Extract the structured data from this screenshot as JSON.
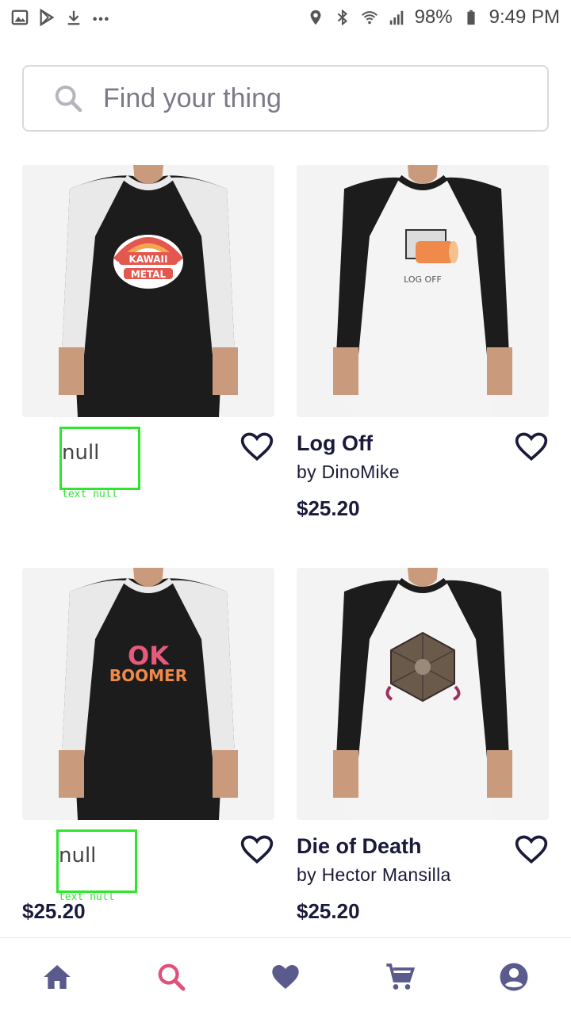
{
  "status_bar": {
    "battery": "98%",
    "time": "9:49 PM",
    "left_icons": [
      "gallery-icon",
      "play-store-icon",
      "download-icon",
      "more-icon"
    ],
    "right_icons": [
      "location-icon",
      "bluetooth-icon",
      "wifi-icon",
      "signal-icon",
      "battery-icon"
    ]
  },
  "search": {
    "placeholder": "Find your thing",
    "icon": "search-icon"
  },
  "products": [
    {
      "title": "null",
      "artist": "",
      "price": "",
      "debug_label": "text null",
      "design": "KAWAII METAL",
      "shirt": "black body, white sleeves"
    },
    {
      "title": "Log Off",
      "artist": "by DinoMike",
      "price": "$25.20",
      "design": "LOG OFF",
      "shirt": "white body, black sleeves"
    },
    {
      "title": "null",
      "artist": "",
      "price": "$25.20",
      "debug_label": "text null",
      "design": "OK BOOMER",
      "shirt": "black body, white sleeves"
    },
    {
      "title": "Die of Death",
      "artist": "by Hector Mansilla",
      "price": "$25.20",
      "design": "d20 die illustration",
      "shirt": "white body, black sleeves"
    }
  ],
  "bottom_nav": [
    {
      "name": "home",
      "icon": "home-icon",
      "active": false
    },
    {
      "name": "search",
      "icon": "search-icon",
      "active": true
    },
    {
      "name": "favorites",
      "icon": "heart-icon",
      "active": false
    },
    {
      "name": "cart",
      "icon": "cart-icon",
      "active": false
    },
    {
      "name": "account",
      "icon": "account-icon",
      "active": false
    }
  ],
  "colors": {
    "nav_icon": "#5a5a8c",
    "nav_active": "#e0507a",
    "text": "#1a1a3a",
    "debug_outline": "#2ee62e"
  }
}
